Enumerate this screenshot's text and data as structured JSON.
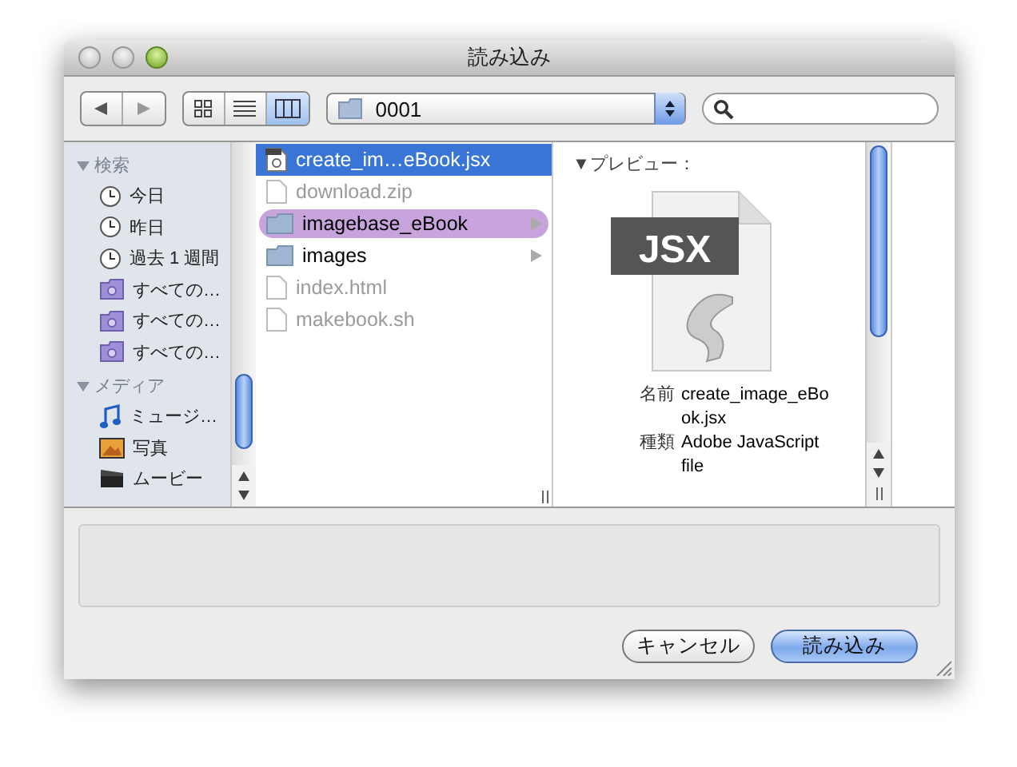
{
  "window": {
    "title": "読み込み"
  },
  "toolbar": {
    "view_modes": [
      {
        "kind": "icon",
        "selected": false
      },
      {
        "kind": "list",
        "selected": false
      },
      {
        "kind": "column",
        "selected": true
      }
    ],
    "path": "0001"
  },
  "sidebar": {
    "sections": [
      {
        "title": "検索",
        "expanded": true,
        "items": [
          {
            "label": "今日",
            "kind": "clock"
          },
          {
            "label": "昨日",
            "kind": "clock"
          },
          {
            "label": "過去 1 週間",
            "kind": "clock"
          },
          {
            "label": "すべての…",
            "kind": "smart-folder"
          },
          {
            "label": "すべての…",
            "kind": "smart-folder"
          },
          {
            "label": "すべての…",
            "kind": "smart-folder"
          }
        ]
      },
      {
        "title": "メディア",
        "expanded": true,
        "items": [
          {
            "label": "ミュージ…",
            "kind": "music"
          },
          {
            "label": "写真",
            "kind": "photo"
          },
          {
            "label": "ムービー",
            "kind": "movie"
          }
        ]
      }
    ]
  },
  "column": {
    "items": [
      {
        "name": "create_im…eBook.jsx",
        "kind": "script",
        "selected": true,
        "disabled": false
      },
      {
        "name": "download.zip",
        "kind": "file",
        "selected": false,
        "disabled": true
      },
      {
        "name": "imagebase_eBook",
        "kind": "folder",
        "selected": false,
        "disabled": false,
        "color": "#c8a4dc"
      },
      {
        "name": "images",
        "kind": "folder",
        "selected": false,
        "disabled": false
      },
      {
        "name": "index.html",
        "kind": "file",
        "selected": false,
        "disabled": true
      },
      {
        "name": "makebook.sh",
        "kind": "file",
        "selected": false,
        "disabled": true
      }
    ]
  },
  "preview": {
    "heading": "▼プレビュー：",
    "icon_label": "JSX",
    "info": [
      {
        "label": "名前",
        "value": "create_image_eBook.jsx"
      },
      {
        "label": "種類",
        "value": "Adobe JavaScript file"
      }
    ]
  },
  "buttons": [
    {
      "label": "キャンセル",
      "kind": "default"
    },
    {
      "label": "読み込み",
      "kind": "primary"
    }
  ]
}
